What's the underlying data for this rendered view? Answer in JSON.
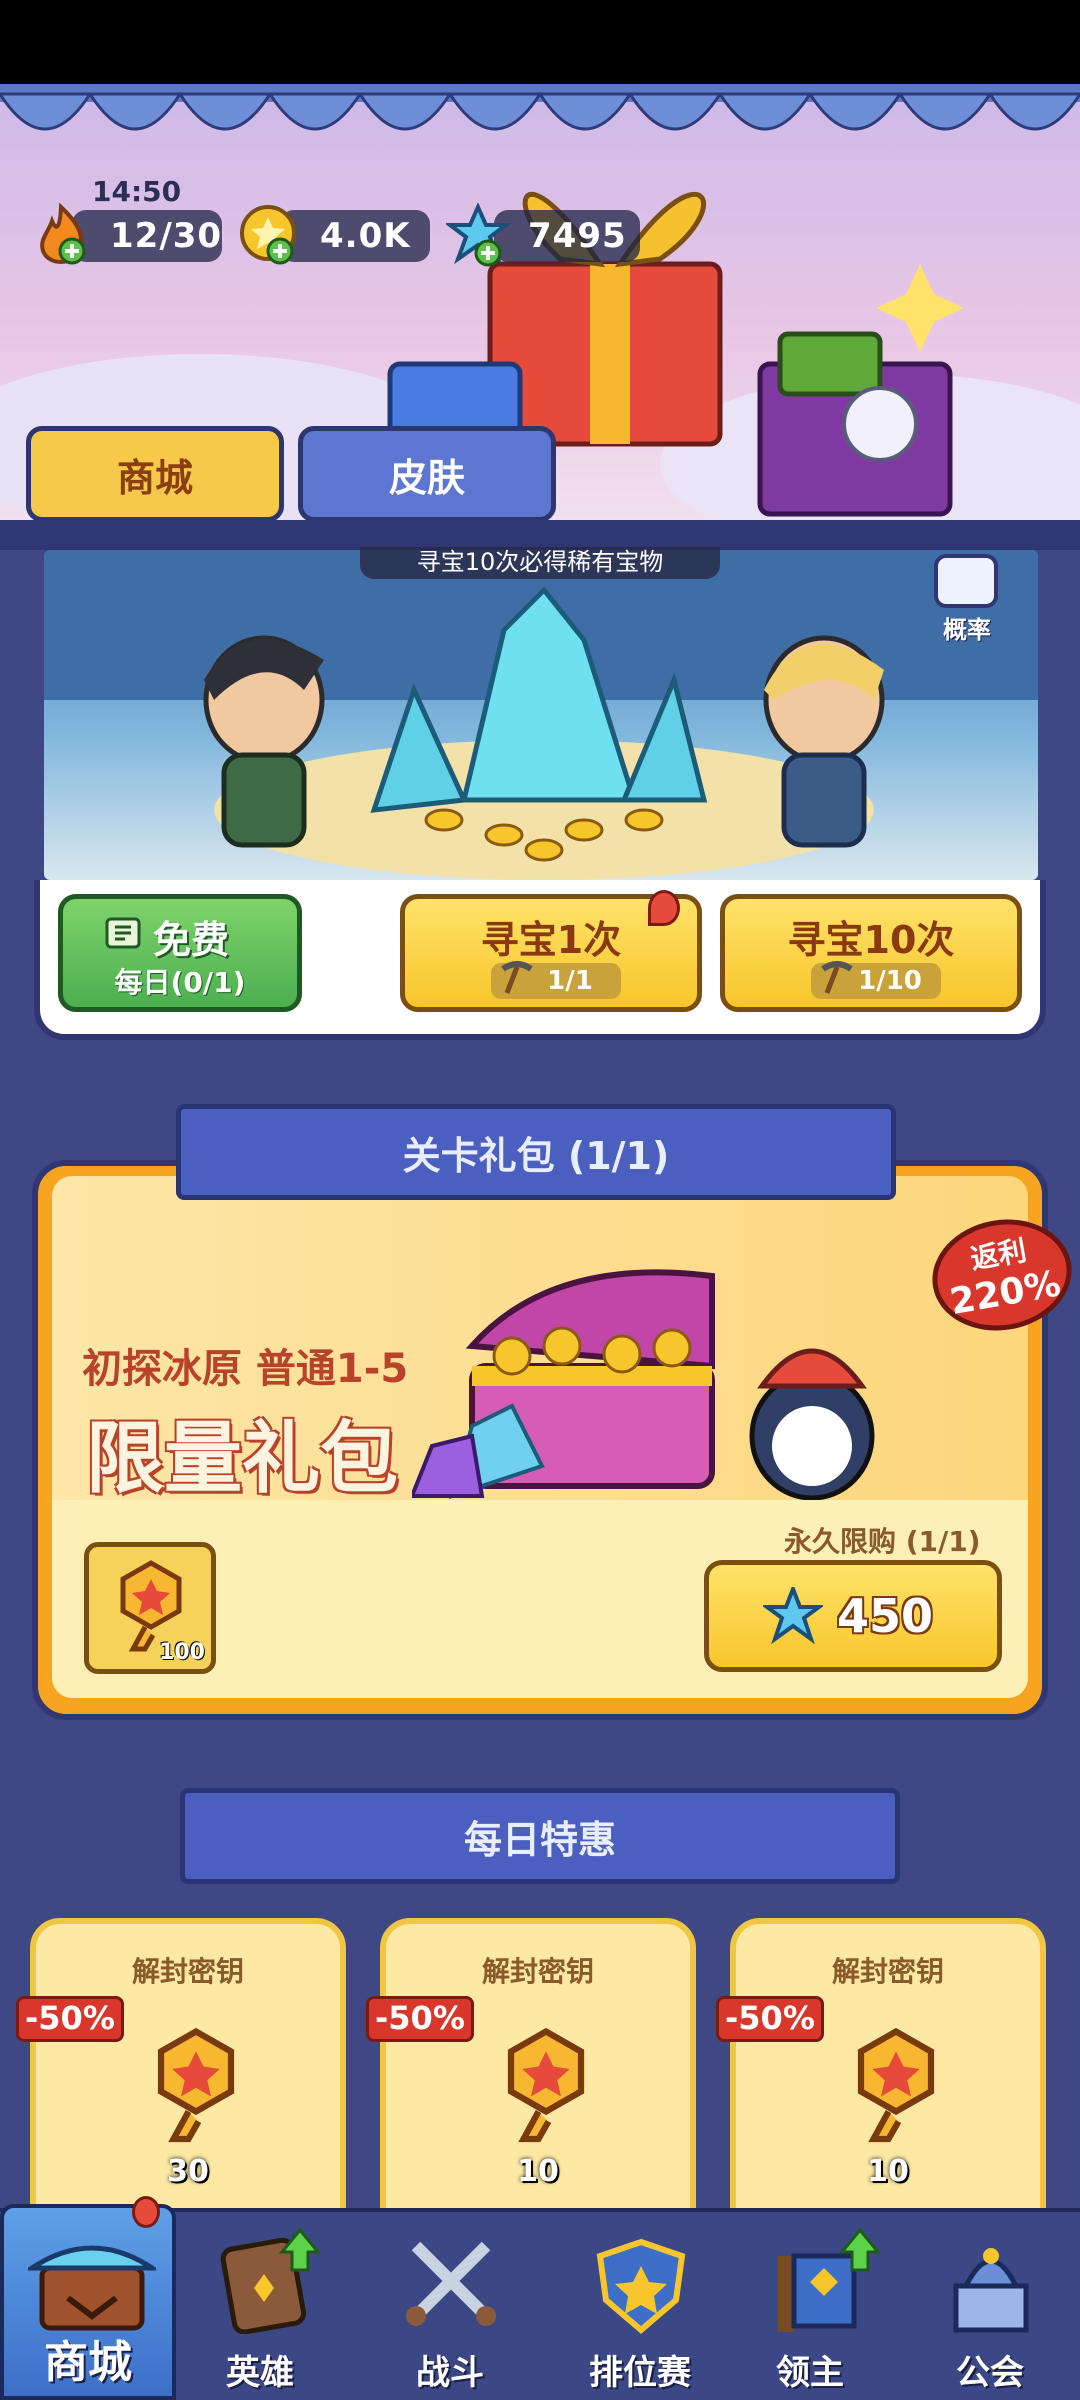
{
  "status": {
    "time": "14:50"
  },
  "resources": {
    "stamina": "12/30",
    "gold": "4.0K",
    "gems": "7495"
  },
  "tabs": {
    "shop": "商城",
    "skins": "皮肤"
  },
  "treasure": {
    "hint": "寻宝10次必得稀有宝物",
    "probability_label": "概率",
    "free_title": "免费",
    "free_sub": "每日(0/1)",
    "once_title": "寻宝1次",
    "once_cost": "1/1",
    "ten_title": "寻宝10次",
    "ten_cost": "1/10"
  },
  "level_pack": {
    "ribbon": "关卡礼包 (1/1)",
    "subtitle": "初探冰原 普通1-5",
    "title": "限量礼包",
    "rebate_label": "返利",
    "rebate_value": "220%",
    "item_count": "100",
    "limit": "永久限购 (1/1)",
    "price": "450"
  },
  "daily_deals": {
    "ribbon": "每日特惠",
    "items": [
      {
        "title": "解封密钥",
        "discount": "-50%",
        "count": "30"
      },
      {
        "title": "解封密钥",
        "discount": "-50%",
        "count": "10"
      },
      {
        "title": "解封密钥",
        "discount": "-50%",
        "count": "10"
      }
    ]
  },
  "nav": {
    "items": [
      {
        "label": "商城"
      },
      {
        "label": "英雄"
      },
      {
        "label": "战斗"
      },
      {
        "label": "排位赛"
      },
      {
        "label": "领主"
      },
      {
        "label": "公会"
      }
    ]
  },
  "colors": {
    "accent_yellow": "#f7c62a",
    "brand_blue": "#4a5fbf",
    "green": "#4caf50",
    "red": "#d9372b"
  }
}
